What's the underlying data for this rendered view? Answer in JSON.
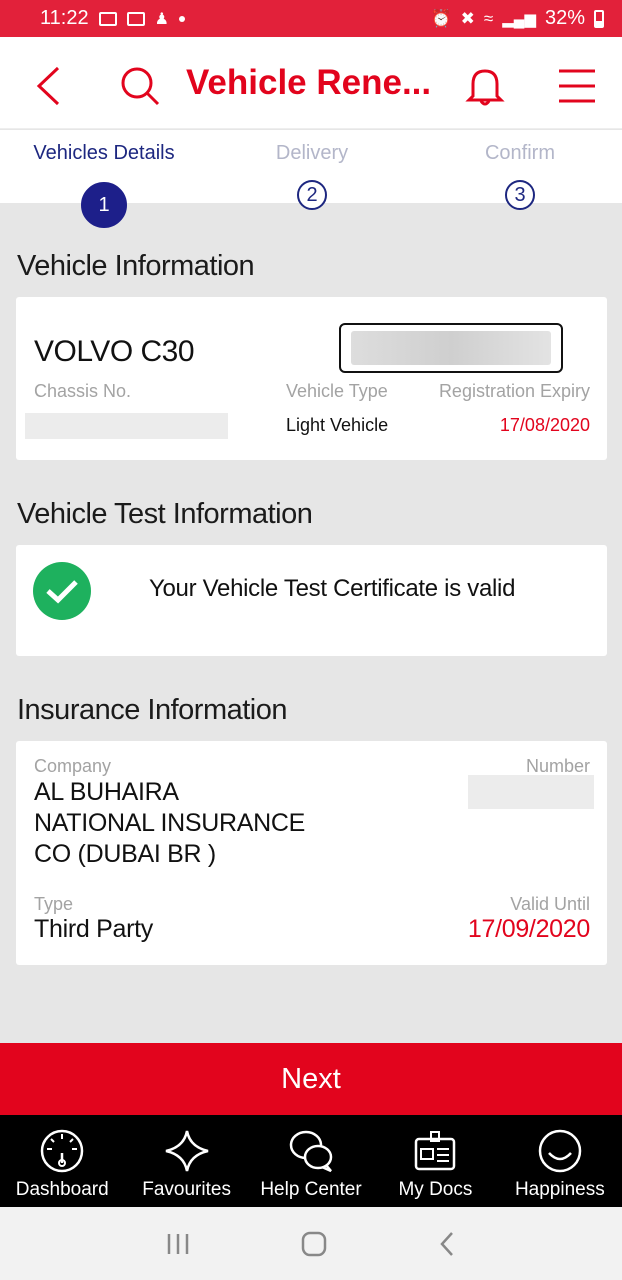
{
  "status_bar": {
    "time": "11:22",
    "battery": "32%"
  },
  "header": {
    "title": "Vehicle Rene..."
  },
  "steps": [
    {
      "label": "Vehicles Details",
      "number": "1"
    },
    {
      "label": "Delivery",
      "number": "2"
    },
    {
      "label": "Confirm",
      "number": "3"
    }
  ],
  "vehicle": {
    "section_title": "Vehicle Information",
    "name": "VOLVO C30",
    "chassis_label": "Chassis No.",
    "type_label": "Vehicle Type",
    "type_value": "Light Vehicle",
    "expiry_label": "Registration Expiry",
    "expiry_value": "17/08/2020"
  },
  "test": {
    "section_title": "Vehicle Test Information",
    "message": "Your Vehicle Test Certificate is valid"
  },
  "insurance": {
    "section_title": "Insurance Information",
    "company_label": "Company",
    "company_lines": [
      "AL BUHAIRA",
      "NATIONAL INSURANCE",
      "CO (DUBAI BR )"
    ],
    "number_label": "Number",
    "type_label": "Type",
    "type_value": "Third Party",
    "valid_label": "Valid Until",
    "valid_value": "17/09/2020"
  },
  "next_label": "Next",
  "bottom_nav": [
    {
      "label": "Dashboard",
      "icon": "dashboard-icon"
    },
    {
      "label": "Favourites",
      "icon": "star-icon"
    },
    {
      "label": "Help Center",
      "icon": "chat-icon"
    },
    {
      "label": "My Docs",
      "icon": "docs-icon"
    },
    {
      "label": "Happiness",
      "icon": "smile-icon"
    }
  ],
  "colors": {
    "brand_red": "#e2041d",
    "status_red": "#e2213a",
    "step_blue": "#1d1f8a",
    "success_green": "#1eb15e"
  }
}
